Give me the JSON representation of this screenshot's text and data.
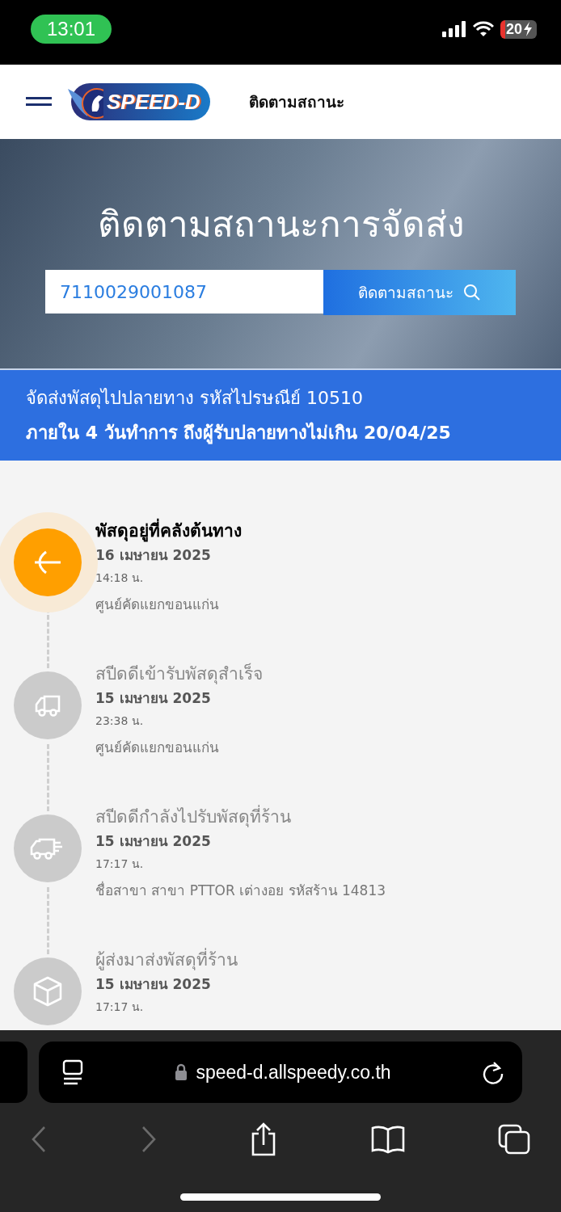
{
  "status_bar": {
    "time": "13:01",
    "battery": "20"
  },
  "header": {
    "logo_text": "SPEED-D",
    "nav_link": "ติดตามสถานะ"
  },
  "hero": {
    "title": "ติดตามสถานะการจัดส่ง",
    "tracking_number": "7110029001087",
    "track_button": "ติดตามสถานะ"
  },
  "banner": {
    "line_1": "จัดส่งพัสดุไปปลายทาง รหัสไปรษณีย์ 10510",
    "line_2": "ภายใน 4 วันทำการ ถึงผู้รับปลายทางไม่เกิน 20/04/25"
  },
  "timeline": [
    {
      "kind": "warehouse",
      "active": true,
      "title": "พัสดุอยู่ที่คลังต้นทาง",
      "date": "16 เมษายน 2025",
      "time": "14:18 น.",
      "location": "ศูนย์คัดแยกขอนแก่น"
    },
    {
      "kind": "truck",
      "active": false,
      "title": "สปีดดีเข้ารับพัสดุสำเร็จ",
      "date": "15 เมษายน 2025",
      "time": "23:38 น.",
      "location": "ศูนย์คัดแยกขอนแก่น"
    },
    {
      "kind": "truck-fast",
      "active": false,
      "title": "สปีดดีกำลังไปรับพัสดุที่ร้าน",
      "date": "15 เมษายน 2025",
      "time": "17:17 น.",
      "location": "ชื่อสาขา สาขา PTTOR เต่างอย รหัสร้าน 14813"
    },
    {
      "kind": "box",
      "active": false,
      "title": "ผู้ส่งมาส่งพัสดุที่ร้าน",
      "date": "15 เมษายน 2025",
      "time": "17:17 น."
    }
  ],
  "browser": {
    "url": "speed-d.allspeedy.co.th",
    "nav": [
      {
        "kind": "back",
        "disabled": true
      },
      {
        "kind": "forward",
        "disabled": true
      },
      {
        "kind": "share",
        "disabled": false
      },
      {
        "kind": "bookmarks",
        "disabled": false
      },
      {
        "kind": "tabs",
        "disabled": false
      }
    ]
  }
}
